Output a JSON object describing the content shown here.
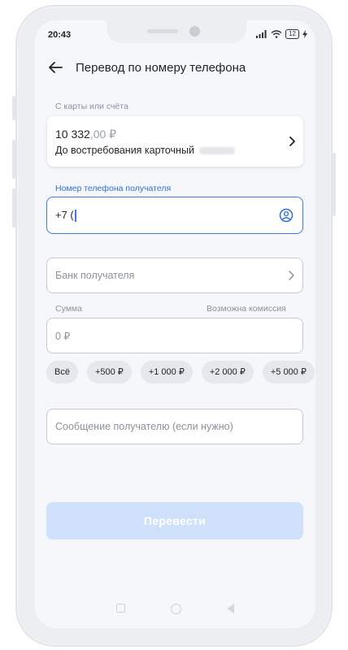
{
  "status_bar": {
    "time": "20:43",
    "battery": "12"
  },
  "header": {
    "title": "Перевод по номеру телефона"
  },
  "source": {
    "label": "С карты или счёта",
    "amount_main": "10 332",
    "amount_decimal": ",00 ₽",
    "account_name": "До востребования карточный"
  },
  "phone": {
    "label": "Номер телефона получателя",
    "value": "+7 ("
  },
  "bank": {
    "placeholder": "Банк получателя"
  },
  "sum": {
    "label": "Сумма",
    "commission": "Возможна комиссия",
    "placeholder": "0 ₽"
  },
  "chips": [
    "Всё",
    "+500 ₽",
    "+1 000 ₽",
    "+2 000 ₽",
    "+5 000 ₽"
  ],
  "message": {
    "placeholder": "Сообщение получателю (если нужно)"
  },
  "submit": {
    "label": "Перевести"
  },
  "colors": {
    "accent": "#3d7be8",
    "submit_disabled": "#cfe0fb",
    "background": "#f6f7fb"
  }
}
